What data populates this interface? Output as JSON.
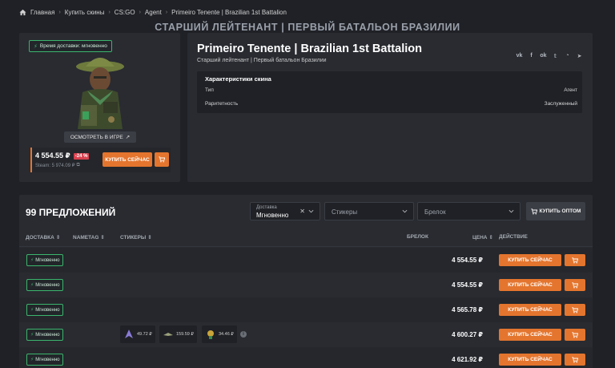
{
  "breadcrumb": [
    "Главная",
    "Купить скины",
    "CS:GO",
    "Agent",
    "Primeiro Tenente | Brazilian 1st Battalion"
  ],
  "page_heading": "СТАРШИЙ ЛЕЙТЕНАНТ | ПЕРВЫЙ БАТАЛЬОН БРАЗИЛИИ",
  "left_card": {
    "delivery_badge": "Время доставки: мгновенно",
    "view_in_game": "ОСМОТРЕТЬ В ИГРЕ",
    "price": "4 554.55 ₽",
    "discount": "-24 %",
    "steam_price": "Steam: 5 974.09 ₽",
    "buy_now": "КУПИТЬ СЕЙЧАС"
  },
  "item": {
    "title": "Primeiro Tenente | Brazilian 1st Battalion",
    "subtitle": "Старший лейтенант | Первый батальон Бразилии",
    "socials": [
      "vk-icon",
      "facebook-icon",
      "odnoklassniki-icon",
      "twitter-icon",
      "whatsapp-icon",
      "telegram-icon"
    ],
    "specs_title": "Характеристики скина",
    "specs": [
      {
        "label": "Тип",
        "value": "Агент"
      },
      {
        "label": "Раритетность",
        "value": "Заслуженный"
      }
    ]
  },
  "offers": {
    "title": "99 ПРЕДЛОЖЕНИЙ",
    "filter_delivery_label": "Доставка",
    "filter_delivery_value": "Мгновенно",
    "filter_stickers": "Стикеры",
    "filter_charm": "Брелок",
    "bulk_buy": "КУПИТЬ ОПТОМ",
    "columns": {
      "delivery": "ДОСТАВКА",
      "nametag": "NAMETAG",
      "stickers": "СТИКЕРЫ",
      "charm": "БРЕЛОК",
      "price": "ЦЕНА",
      "action": "ДЕЙСТВИЕ"
    },
    "badge": "Мгновенно",
    "buy_now": "КУПИТЬ СЕЙЧАС",
    "rows": [
      {
        "price": "4 554.55 ₽"
      },
      {
        "price": "4 554.55 ₽"
      },
      {
        "price": "4 565.78 ₽"
      },
      {
        "price": "4 600.27 ₽",
        "stickers": [
          "49.72 ₽",
          "159.59 ₽",
          "34.46 ₽"
        ]
      },
      {
        "price": "4 621.92 ₽"
      }
    ]
  },
  "colors": {
    "accent": "#e4752e",
    "instant": "#3bb56c",
    "discount": "#d8414e",
    "panel": "#292b31",
    "background": "#1f2126"
  }
}
